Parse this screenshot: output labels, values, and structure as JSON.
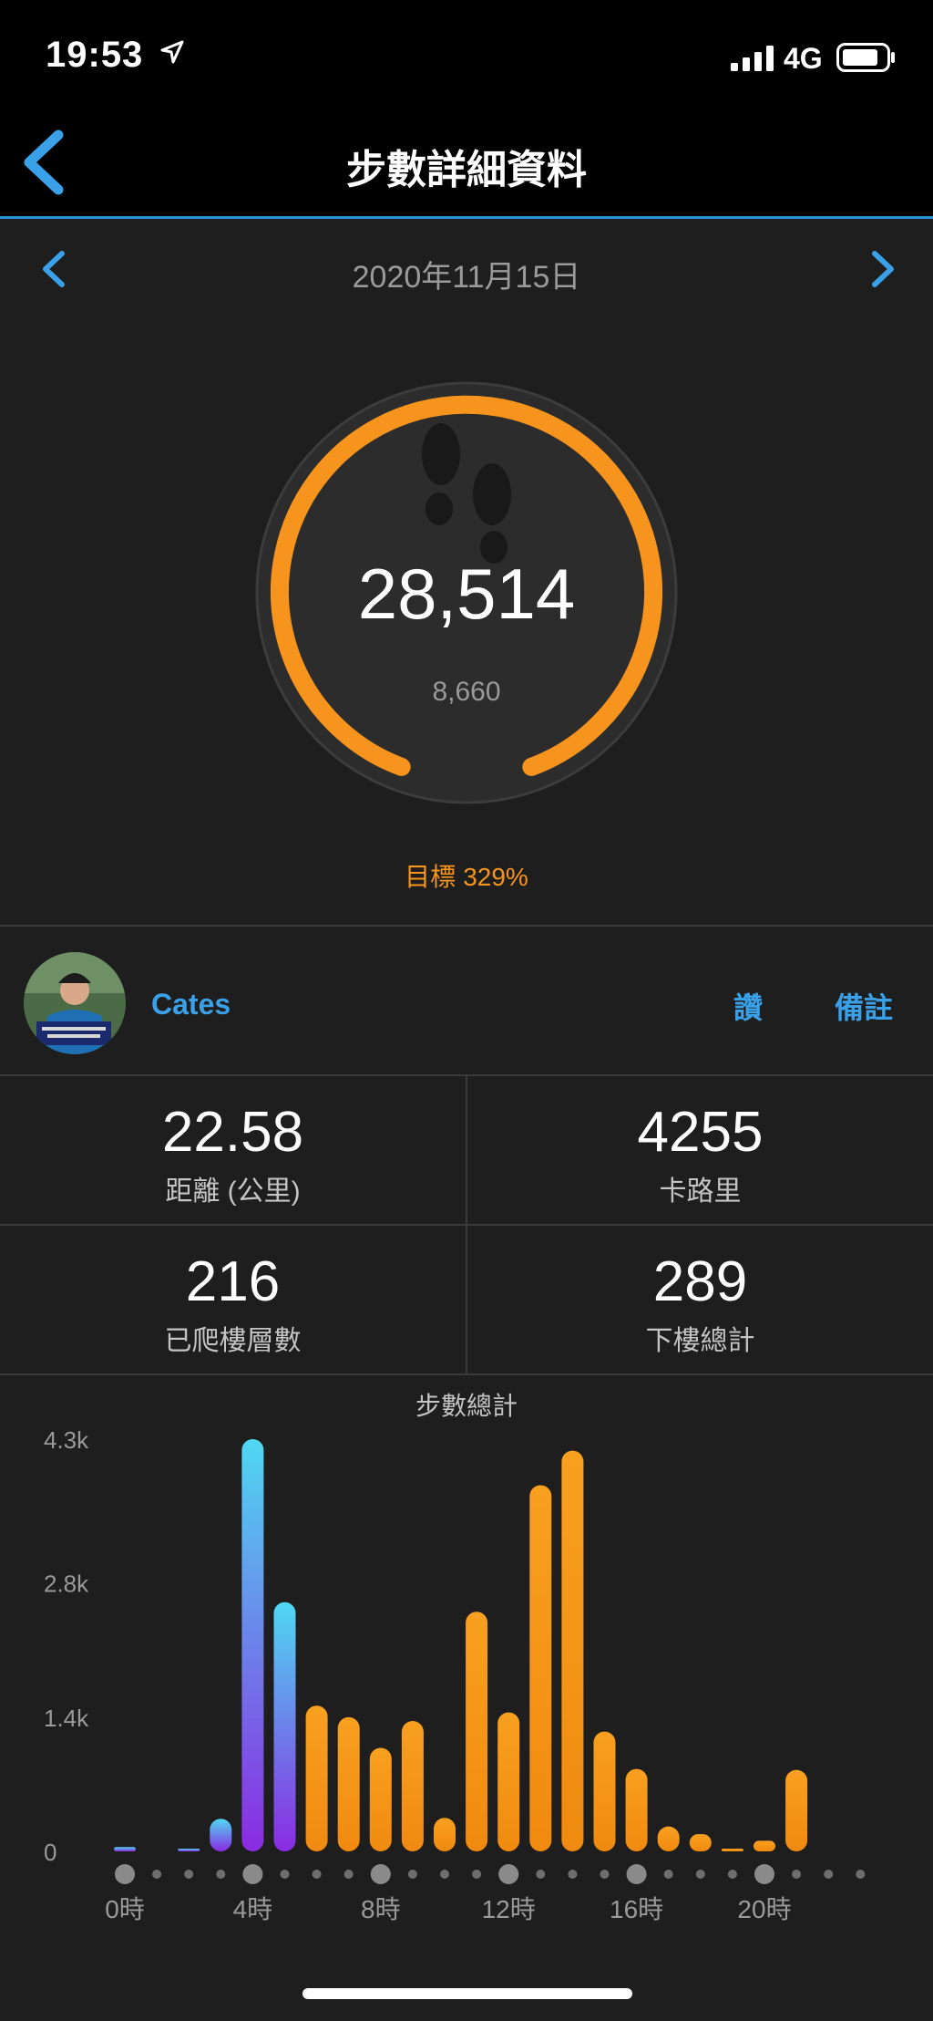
{
  "status_bar": {
    "time": "19:53",
    "network": "4G",
    "icons": [
      "location-arrow-icon",
      "signal-bars-icon",
      "battery-icon"
    ]
  },
  "header": {
    "title": "步數詳細資料",
    "back_icon": "chevron-left-icon"
  },
  "date_nav": {
    "date": "2020年11月15日",
    "prev_icon": "chevron-left-icon",
    "next_icon": "chevron-right-icon"
  },
  "steps": {
    "total": "28,514",
    "goal": "8,660",
    "goal_label": "目標",
    "goal_percent": "329%",
    "goal_fraction": 3.29,
    "icon": "footprints-icon"
  },
  "user": {
    "name": "Cates",
    "like_label": "讚",
    "note_label": "備註"
  },
  "stats": [
    {
      "value": "22.58",
      "label": "距離 (公里)"
    },
    {
      "value": "4255",
      "label": "卡路里"
    },
    {
      "value": "216",
      "label": "已爬樓層數"
    },
    {
      "value": "289",
      "label": "下樓總計"
    }
  ],
  "colors": {
    "accent_blue": "#3aa0e8",
    "ring_orange": "#f7941d",
    "bar_orange": "#f7941d",
    "bar_gradient_top": "#4fd8f2",
    "bar_gradient_bottom": "#8a2be2",
    "background": "#1e1e1e"
  },
  "chart_data": {
    "type": "bar",
    "title": "步數總計",
    "y_ticks": [
      "4.3k",
      "2.8k",
      "1.4k",
      "0"
    ],
    "y_tick_values": [
      4300,
      2800,
      1400,
      0
    ],
    "ylim": [
      0,
      4300
    ],
    "x_tick_labels": [
      "0時",
      "4時",
      "8時",
      "12時",
      "16時",
      "20時"
    ],
    "x_tick_hours": [
      0,
      4,
      8,
      12,
      16,
      20
    ],
    "hours": [
      0,
      1,
      2,
      3,
      4,
      5,
      6,
      7,
      8,
      9,
      10,
      11,
      12,
      13,
      14,
      15,
      16,
      17,
      18,
      19,
      20,
      21,
      22,
      23
    ],
    "values": [
      45,
      0,
      15,
      340,
      4300,
      2600,
      1520,
      1400,
      1080,
      1360,
      350,
      2500,
      1450,
      3820,
      4180,
      1250,
      860,
      260,
      180,
      20,
      110,
      850,
      0,
      0
    ],
    "colors_by_hour": [
      "gradient",
      "gradient",
      "gradient",
      "gradient",
      "gradient",
      "gradient",
      "orange",
      "orange",
      "orange",
      "orange",
      "orange",
      "orange",
      "orange",
      "orange",
      "orange",
      "orange",
      "orange",
      "orange",
      "orange",
      "orange",
      "orange",
      "orange",
      "orange",
      "orange"
    ],
    "grid": false,
    "legend": "none"
  }
}
